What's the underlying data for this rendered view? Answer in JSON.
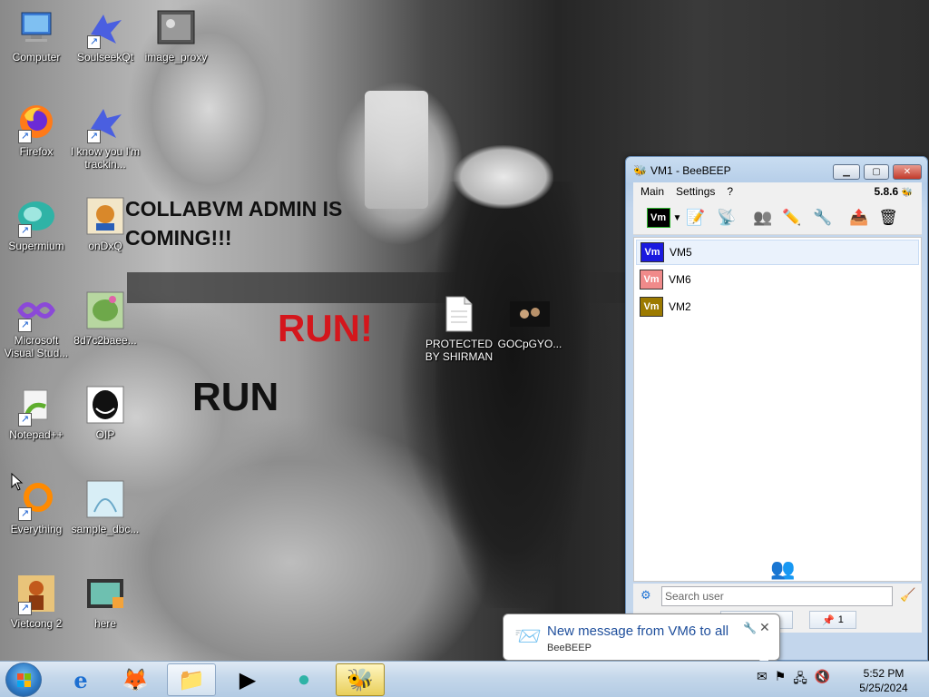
{
  "desktop": {
    "overlay_texts": {
      "collab": "COLLABVM ADMIN IS COMING!!!",
      "run_red": "RUN!",
      "run_black": "RUN"
    },
    "icons": [
      {
        "label": "Computer"
      },
      {
        "label": "SoulseekQt"
      },
      {
        "label": "image_proxy"
      },
      {
        "label": "Firefox"
      },
      {
        "label": "I know you I'm trackin..."
      },
      {
        "label": "Supermium"
      },
      {
        "label": "onDxQ"
      },
      {
        "label": "Microsoft Visual Stud..."
      },
      {
        "label": "8d7c2baee..."
      },
      {
        "label": "Notepad++"
      },
      {
        "label": "OIP"
      },
      {
        "label": "Everything"
      },
      {
        "label": "sample_dbc..."
      },
      {
        "label": "Vietcong 2"
      },
      {
        "label": "here"
      },
      {
        "label": "PROTECTED BY SHIRMAN"
      },
      {
        "label": "GOCpGYO..."
      }
    ]
  },
  "beebeep": {
    "title": "VM1 - BeeBEEP",
    "menu": [
      "Main",
      "Settings",
      "?"
    ],
    "version": "5.8.6",
    "toolbar_badge": "Vm",
    "users": [
      {
        "name": "VM5",
        "badge": "Vm",
        "color": "#1a1adf"
      },
      {
        "name": "VM6",
        "badge": "Vm",
        "color": "#f08a8a"
      },
      {
        "name": "VM2",
        "badge": "Vm",
        "color": "#9c7a00"
      }
    ],
    "search_placeholder": "Search user",
    "status_count": "1"
  },
  "notification": {
    "message": "New message from VM6 to all",
    "app": "BeeBEEP"
  },
  "taskbar": {
    "time": "5:52 PM",
    "date": "5/25/2024"
  }
}
